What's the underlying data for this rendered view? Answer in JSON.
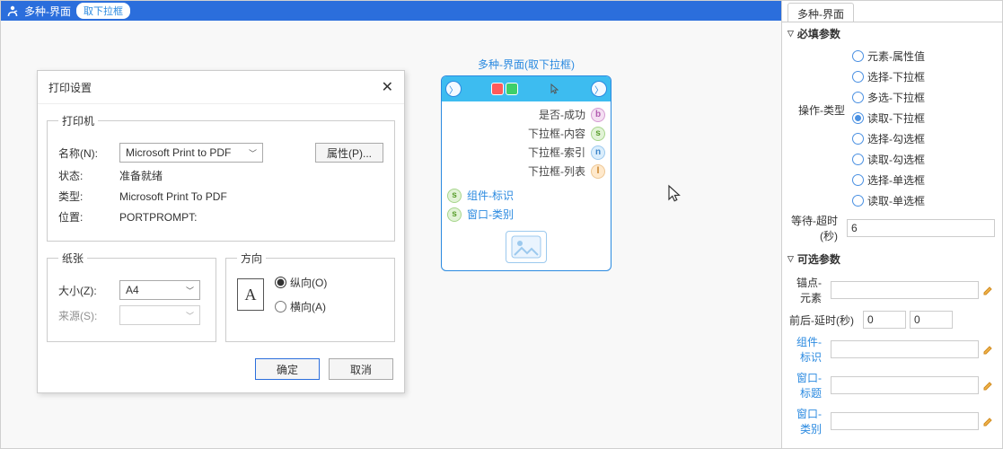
{
  "ribbon": {
    "title": "多种-界面",
    "pill": "取下拉框"
  },
  "printDialog": {
    "title": "打印设置",
    "printerLegend": "打印机",
    "nameLabel": "名称(N):",
    "nameValue": "Microsoft Print to PDF",
    "propsBtn": "属性(P)...",
    "statusLabel": "状态:",
    "statusValue": "准备就绪",
    "typeLabel": "类型:",
    "typeValue": "Microsoft Print To PDF",
    "locationLabel": "位置:",
    "locationValue": "PORTPROMPT:",
    "paperLegend": "纸张",
    "sizeLabel": "大小(Z):",
    "sizeValue": "A4",
    "sourceLabel": "来源(S):",
    "sourceValue": "",
    "orientLegend": "方向",
    "portrait": "纵向(O)",
    "landscape": "横向(A)",
    "ok": "确定",
    "cancel": "取消"
  },
  "node": {
    "title": "多种-界面(取下拉框)",
    "outputs": [
      "是否-成功",
      "下拉框-内容",
      "下拉框-索引",
      "下拉框-列表"
    ],
    "outputTypes": [
      "b",
      "s",
      "n",
      "l"
    ],
    "inputs": [
      "组件-标识",
      "窗口-类别"
    ]
  },
  "side": {
    "tab": "多种-界面",
    "requiredHeader": "必填参数",
    "opLabel": "操作-类型",
    "opOptions": [
      "元素-属性值",
      "选择-下拉框",
      "多选-下拉框",
      "读取-下拉框",
      "选择-勾选框",
      "读取-勾选框",
      "选择-单选框",
      "读取-单选框"
    ],
    "opSelectedIndex": 3,
    "timeoutLabel": "等待-超时(秒)",
    "timeoutValue": "6",
    "optionalHeader": "可选参数",
    "anchorLabel": "锚点-元素",
    "delayLabel": "前后-延时(秒)",
    "delayBefore": "0",
    "delayAfter": "0",
    "compIdLabel": "组件-标识",
    "winTitleLabel": "窗口-标题",
    "winClassLabel": "窗口-类别"
  }
}
